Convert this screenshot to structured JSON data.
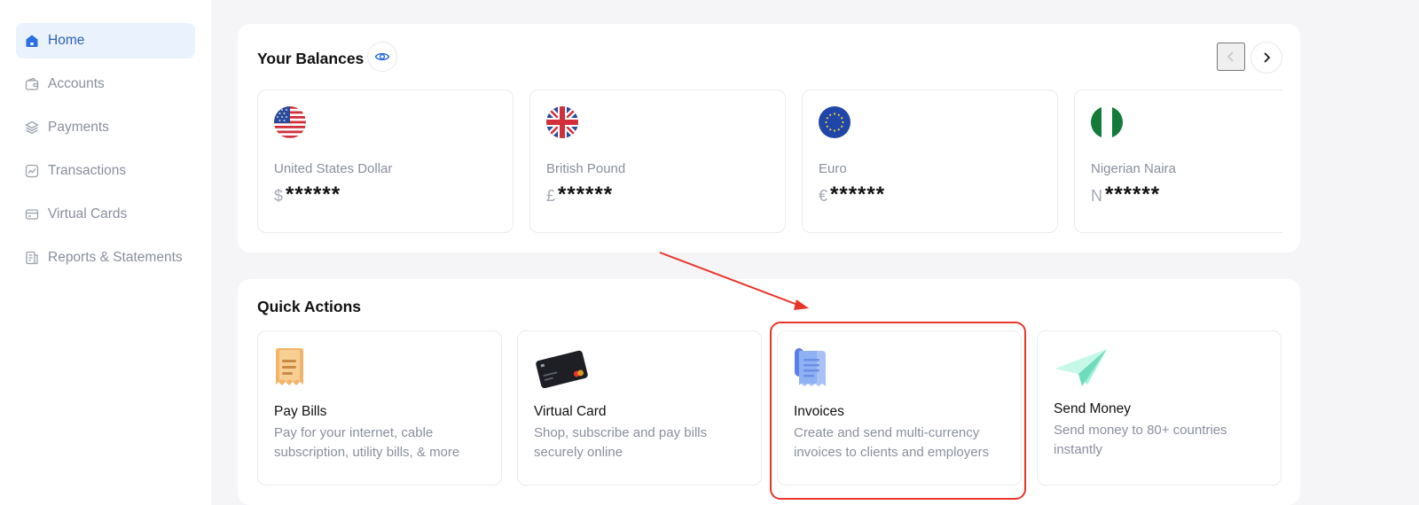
{
  "sidebar": {
    "items": [
      {
        "label": "Home",
        "icon": "home-icon",
        "active": true
      },
      {
        "label": "Accounts",
        "icon": "wallet-icon",
        "active": false
      },
      {
        "label": "Payments",
        "icon": "layers-icon",
        "active": false
      },
      {
        "label": "Transactions",
        "icon": "chart-icon",
        "active": false
      },
      {
        "label": "Virtual Cards",
        "icon": "card-icon",
        "active": false
      },
      {
        "label": "Reports & Statements",
        "icon": "report-icon",
        "active": false
      }
    ]
  },
  "balances": {
    "title": "Your Balances",
    "cards": [
      {
        "currency": "United States Dollar",
        "symbol": "$",
        "amount": "******",
        "flag": "us-flag-icon"
      },
      {
        "currency": "British Pound",
        "symbol": "£",
        "amount": "******",
        "flag": "uk-flag-icon"
      },
      {
        "currency": "Euro",
        "symbol": "€",
        "amount": "******",
        "flag": "eu-flag-icon"
      },
      {
        "currency": "Nigerian Naira",
        "symbol": "N",
        "amount": "******",
        "flag": "ng-flag-icon"
      }
    ]
  },
  "quick_actions": {
    "title": "Quick Actions",
    "cards": [
      {
        "title": "Pay Bills",
        "description": "Pay for your internet, cable subscription, utility bills, & more",
        "icon": "bill-receipt-icon"
      },
      {
        "title": "Virtual Card",
        "description": "Shop, subscribe and pay bills securely online",
        "icon": "credit-card-icon"
      },
      {
        "title": "Invoices",
        "description": "Create and send multi-currency invoices to clients and employers",
        "icon": "invoice-icon"
      },
      {
        "title": "Send Money",
        "description": "Send money to 80+ countries instantly",
        "icon": "paper-plane-icon"
      }
    ]
  },
  "colors": {
    "accent": "#2c5fb8",
    "active_bg": "#eaf2fd",
    "annotation": "#e8352a"
  }
}
